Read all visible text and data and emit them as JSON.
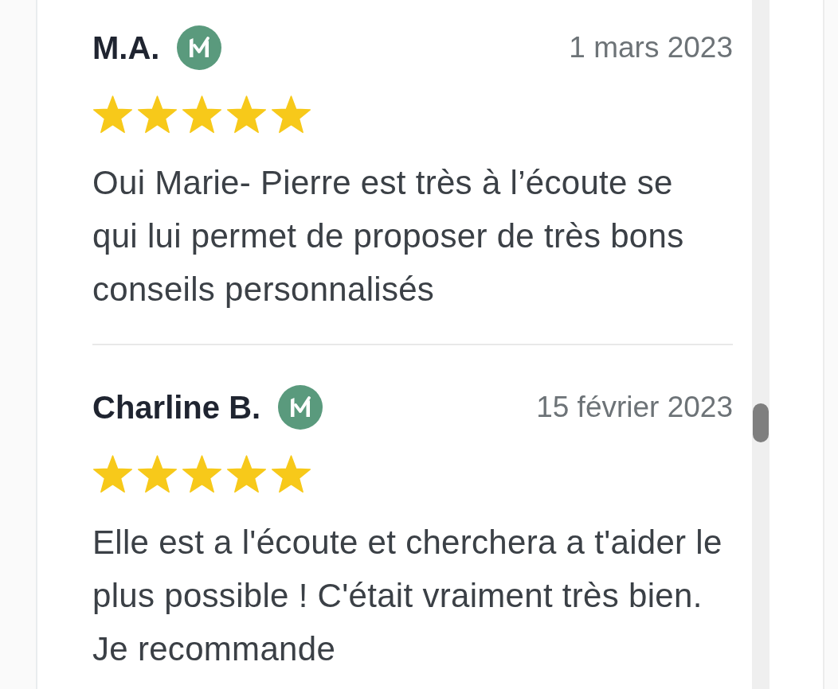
{
  "reviews": [
    {
      "author": "M.A.",
      "verified": true,
      "date": "1 mars 2023",
      "stars": 5,
      "text_lines": [
        "Oui Marie- Pierre est très à l’écoute se",
        "qui lui permet de proposer de très bons",
        "conseils personnalisés"
      ]
    },
    {
      "author": "Charline B.",
      "verified": true,
      "date": "15 février 2023",
      "stars": 5,
      "text_lines": [
        "Elle est a l'écoute et cherchera a t'aider le",
        "plus possible ! C'était vraiment très bien.",
        "Je recommande"
      ]
    }
  ]
}
